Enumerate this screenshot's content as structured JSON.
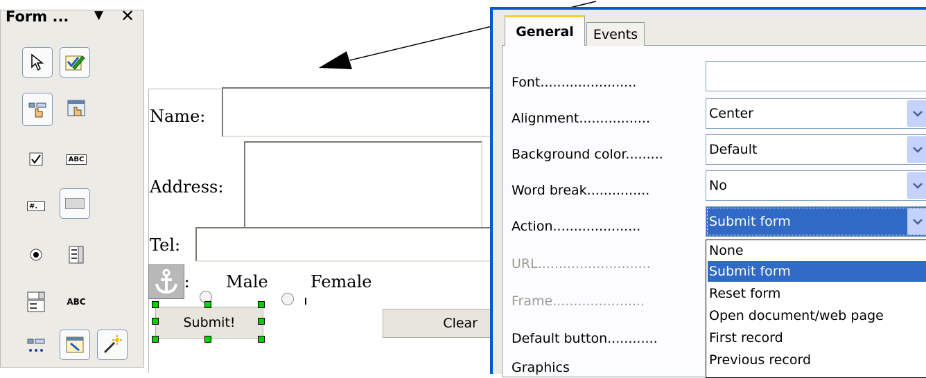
{
  "toolbar": {
    "title": "Form ...",
    "menu_glyph": "▼",
    "close_glyph": "✕",
    "tools": [
      {
        "name": "select-tool",
        "icon": "arrow-pointer-icon"
      },
      {
        "name": "design-mode-tool",
        "icon": "design-mode-icon"
      },
      {
        "name": "control-properties-tool",
        "icon": "control-properties-icon"
      },
      {
        "name": "form-properties-tool",
        "icon": "form-properties-icon"
      },
      {
        "name": "checkbox-tool",
        "icon": "checkbox-icon"
      },
      {
        "name": "text-box-tool",
        "icon": "text-box-icon"
      },
      {
        "name": "formatted-field-tool",
        "icon": "formatted-field-icon"
      },
      {
        "name": "push-button-tool",
        "icon": "push-button-icon"
      },
      {
        "name": "option-button-tool",
        "icon": "option-button-icon"
      },
      {
        "name": "list-box-tool",
        "icon": "list-box-icon"
      },
      {
        "name": "combo-box-tool",
        "icon": "combo-box-icon"
      },
      {
        "name": "label-field-tool",
        "icon": "label-field-icon",
        "label": "ABC"
      },
      {
        "name": "more-controls-tool",
        "icon": "more-controls-icon"
      },
      {
        "name": "form-design-tool",
        "icon": "form-design-icon"
      },
      {
        "name": "wizards-tool",
        "icon": "wizards-icon"
      }
    ],
    "small_labels": {
      "text_box": "ABC",
      "formatted": "#."
    }
  },
  "form": {
    "name_label": "Name:",
    "address_label": "Address:",
    "tel_label": "Tel:",
    "sex_label_partial": "t:",
    "male_label": "Male",
    "female_label": "Female",
    "submit_label": "Submit!",
    "clear_label": "Clear",
    "anchor_icon": "anchor-icon"
  },
  "dialog": {
    "tabs": [
      "General",
      "Events"
    ],
    "active_tab": "General",
    "properties": [
      {
        "label": "Font.......................",
        "value": "",
        "has_dropdown": false,
        "disabled": false
      },
      {
        "label": "Alignment.................",
        "value": "Center",
        "has_dropdown": true,
        "disabled": false
      },
      {
        "label": "Background color.........",
        "value": "Default",
        "has_dropdown": true,
        "disabled": false
      },
      {
        "label": "Word break...............",
        "value": "No",
        "has_dropdown": true,
        "disabled": false
      },
      {
        "label": "Action.....................",
        "value": "Submit form",
        "has_dropdown": true,
        "disabled": false
      },
      {
        "label": "URL...........................",
        "value": null,
        "disabled": true
      },
      {
        "label": "Frame......................",
        "value": null,
        "disabled": true
      },
      {
        "label": "Default button............",
        "value": null,
        "disabled": false
      },
      {
        "label": "Graphics",
        "value": null,
        "disabled": false
      }
    ],
    "action_options": [
      "None",
      "Submit form",
      "Reset form",
      "Open document/web page",
      "First record",
      "Previous record"
    ],
    "action_selected": "Submit form"
  },
  "colors": {
    "dialog_border": "#0a57d6",
    "selection": "#316ac5",
    "handle": "#00d000",
    "tab_highlight": "#ffc83c"
  }
}
